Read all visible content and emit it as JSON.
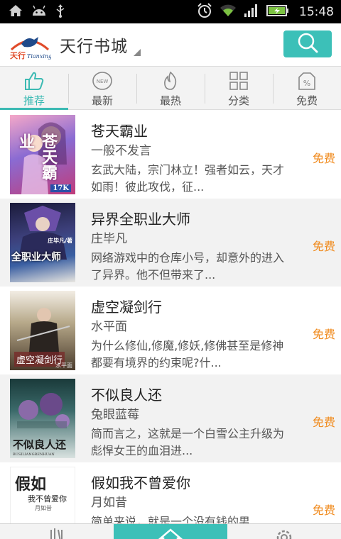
{
  "status_bar": {
    "time": "15:48",
    "icons": [
      "home-icon",
      "android-icon",
      "usb-icon",
      "alarm-icon",
      "wifi-icon",
      "signal-icon",
      "battery-icon"
    ]
  },
  "header": {
    "logo_text": "天行",
    "logo_sub": "Tianxing",
    "title": "天行书城",
    "search_icon": "search-icon",
    "accent_color": "#3cc0b8"
  },
  "tabs": [
    {
      "label": "推荐",
      "icon": "thumbs-up-icon",
      "active": true
    },
    {
      "label": "最新",
      "icon": "new-badge-icon",
      "active": false
    },
    {
      "label": "最热",
      "icon": "flame-icon",
      "active": false
    },
    {
      "label": "分类",
      "icon": "grid-icon",
      "active": false
    },
    {
      "label": "免费",
      "icon": "percent-tag-icon",
      "active": false
    }
  ],
  "books": [
    {
      "title": "苍天霸业",
      "author": "一般不发言",
      "desc": "玄武大陆，宗门林立！强者如云，天才如雨！彼此攻伐，征...",
      "price": "免费",
      "cover_text": "苍天霸业",
      "cover_badge": "17K"
    },
    {
      "title": "异界全职业大师",
      "author": "庄毕凡",
      "desc": "网络游戏中的仓库小号，却意外的进入了异界。他不但带来了...",
      "price": "免费",
      "cover_text": "全职业大师",
      "cover_badge": "庄毕凡/著"
    },
    {
      "title": "虚空凝剑行",
      "author": "水平面",
      "desc": "为什么修仙,修魔,修妖,修佛甚至是修神都要有境界的约束呢?什...",
      "price": "免费",
      "cover_text": "虚空凝剑行",
      "cover_badge": "水平面"
    },
    {
      "title": "不似良人还",
      "author": "兔眼蓝莓",
      "desc": "简而言之，这就是一个白雪公主升级为彪悍女王的血泪进...",
      "price": "免费",
      "cover_text": "不似良人还",
      "cover_badge": "BUSILIANGRENHUAN"
    },
    {
      "title": "假如我不曾爱你",
      "author": "月如昔",
      "desc": "简单来说，就是一个没有钱的男...",
      "price": "免费",
      "cover_text": "假如",
      "cover_sub": "我不曾爱你",
      "cover_badge": "月如昔"
    }
  ],
  "bottom_nav": [
    {
      "icon": "bookshelf-icon",
      "active": false
    },
    {
      "icon": "home-icon",
      "active": true
    },
    {
      "icon": "settings-gear-icon",
      "active": false
    }
  ]
}
